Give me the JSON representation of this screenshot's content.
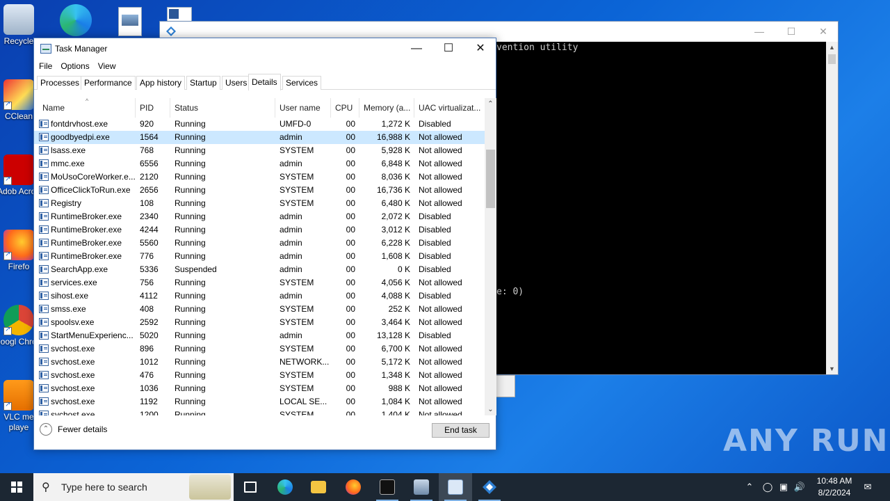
{
  "desktop": {
    "icons": [
      {
        "label": "Recycle",
        "name": "recycle-bin-icon"
      },
      {
        "label": "CClean",
        "name": "ccleaner-icon"
      },
      {
        "label": "Adob Acrob",
        "name": "acrobat-icon"
      },
      {
        "label": "Firefo",
        "name": "firefox-icon"
      },
      {
        "label": "Googl Chrom",
        "name": "chrome-icon"
      },
      {
        "label": "VLC me playe",
        "name": "vlc-icon"
      }
    ]
  },
  "console": {
    "visible_text_1": "vention utility",
    "visible_text_2": "e: 0)"
  },
  "task_manager": {
    "title": "Task Manager",
    "menu": [
      "File",
      "Options",
      "View"
    ],
    "tabs": [
      "Processes",
      "Performance",
      "App history",
      "Startup",
      "Users",
      "Details",
      "Services"
    ],
    "active_tab": "Details",
    "columns": [
      "Name",
      "PID",
      "Status",
      "User name",
      "CPU",
      "Memory (a...",
      "UAC virtualizat..."
    ],
    "rows": [
      {
        "name": "fontdrvhost.exe",
        "pid": "920",
        "status": "Running",
        "user": "UMFD-0",
        "cpu": "00",
        "mem": "1,272 K",
        "uac": "Disabled"
      },
      {
        "name": "goodbyedpi.exe",
        "pid": "1564",
        "status": "Running",
        "user": "admin",
        "cpu": "00",
        "mem": "16,988 K",
        "uac": "Not allowed"
      },
      {
        "name": "lsass.exe",
        "pid": "768",
        "status": "Running",
        "user": "SYSTEM",
        "cpu": "00",
        "mem": "5,928 K",
        "uac": "Not allowed"
      },
      {
        "name": "mmc.exe",
        "pid": "6556",
        "status": "Running",
        "user": "admin",
        "cpu": "00",
        "mem": "6,848 K",
        "uac": "Not allowed"
      },
      {
        "name": "MoUsoCoreWorker.e...",
        "pid": "2120",
        "status": "Running",
        "user": "SYSTEM",
        "cpu": "00",
        "mem": "8,036 K",
        "uac": "Not allowed"
      },
      {
        "name": "OfficeClickToRun.exe",
        "pid": "2656",
        "status": "Running",
        "user": "SYSTEM",
        "cpu": "00",
        "mem": "16,736 K",
        "uac": "Not allowed"
      },
      {
        "name": "Registry",
        "pid": "108",
        "status": "Running",
        "user": "SYSTEM",
        "cpu": "00",
        "mem": "6,480 K",
        "uac": "Not allowed"
      },
      {
        "name": "RuntimeBroker.exe",
        "pid": "2340",
        "status": "Running",
        "user": "admin",
        "cpu": "00",
        "mem": "2,072 K",
        "uac": "Disabled"
      },
      {
        "name": "RuntimeBroker.exe",
        "pid": "4244",
        "status": "Running",
        "user": "admin",
        "cpu": "00",
        "mem": "3,012 K",
        "uac": "Disabled"
      },
      {
        "name": "RuntimeBroker.exe",
        "pid": "5560",
        "status": "Running",
        "user": "admin",
        "cpu": "00",
        "mem": "6,228 K",
        "uac": "Disabled"
      },
      {
        "name": "RuntimeBroker.exe",
        "pid": "776",
        "status": "Running",
        "user": "admin",
        "cpu": "00",
        "mem": "1,608 K",
        "uac": "Disabled"
      },
      {
        "name": "SearchApp.exe",
        "pid": "5336",
        "status": "Suspended",
        "user": "admin",
        "cpu": "00",
        "mem": "0 K",
        "uac": "Disabled"
      },
      {
        "name": "services.exe",
        "pid": "756",
        "status": "Running",
        "user": "SYSTEM",
        "cpu": "00",
        "mem": "4,056 K",
        "uac": "Not allowed"
      },
      {
        "name": "sihost.exe",
        "pid": "4112",
        "status": "Running",
        "user": "admin",
        "cpu": "00",
        "mem": "4,088 K",
        "uac": "Disabled"
      },
      {
        "name": "smss.exe",
        "pid": "408",
        "status": "Running",
        "user": "SYSTEM",
        "cpu": "00",
        "mem": "252 K",
        "uac": "Not allowed"
      },
      {
        "name": "spoolsv.exe",
        "pid": "2592",
        "status": "Running",
        "user": "SYSTEM",
        "cpu": "00",
        "mem": "3,464 K",
        "uac": "Not allowed"
      },
      {
        "name": "StartMenuExperienc...",
        "pid": "5020",
        "status": "Running",
        "user": "admin",
        "cpu": "00",
        "mem": "13,128 K",
        "uac": "Disabled"
      },
      {
        "name": "svchost.exe",
        "pid": "896",
        "status": "Running",
        "user": "SYSTEM",
        "cpu": "00",
        "mem": "6,700 K",
        "uac": "Not allowed"
      },
      {
        "name": "svchost.exe",
        "pid": "1012",
        "status": "Running",
        "user": "NETWORK...",
        "cpu": "00",
        "mem": "5,172 K",
        "uac": "Not allowed"
      },
      {
        "name": "svchost.exe",
        "pid": "476",
        "status": "Running",
        "user": "SYSTEM",
        "cpu": "00",
        "mem": "1,348 K",
        "uac": "Not allowed"
      },
      {
        "name": "svchost.exe",
        "pid": "1036",
        "status": "Running",
        "user": "SYSTEM",
        "cpu": "00",
        "mem": "988 K",
        "uac": "Not allowed"
      },
      {
        "name": "svchost.exe",
        "pid": "1192",
        "status": "Running",
        "user": "LOCAL SE...",
        "cpu": "00",
        "mem": "1,084 K",
        "uac": "Not allowed"
      },
      {
        "name": "svchost.exe",
        "pid": "1200",
        "status": "Running",
        "user": "SYSTEM",
        "cpu": "00",
        "mem": "1,404 K",
        "uac": "Not allowed"
      }
    ],
    "selected_row": "goodbyedpi.exe",
    "fewer_details": "Fewer details",
    "end_task": "End task"
  },
  "watermark": "ANY RUN",
  "taskbar": {
    "search_placeholder": "Type here to search",
    "time": "10:48 AM",
    "date": "8/2/2024"
  },
  "colors": {
    "selection": "#cce8ff",
    "taskbar": "#1c2733",
    "desktop": "#0b64d6"
  }
}
